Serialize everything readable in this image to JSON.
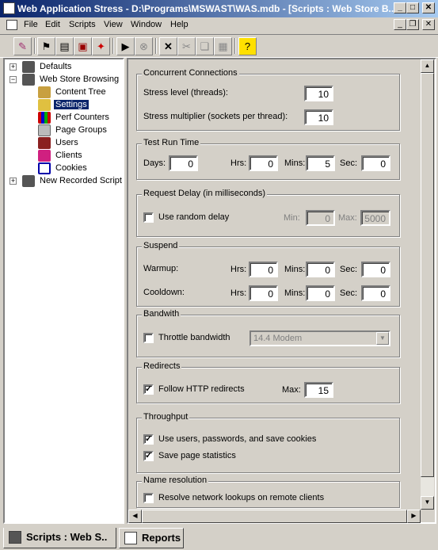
{
  "window": {
    "title": "Web Application Stress - D:\\Programs\\MSWAST\\WAS.mdb - [Scripts : Web Store B...",
    "min": "_",
    "max": "□",
    "close": "✕"
  },
  "menu": [
    "File",
    "Edit",
    "Scripts",
    "View",
    "Window",
    "Help"
  ],
  "toolbar": {
    "icons": [
      "wizard-icon",
      "new-script-icon",
      "properties-icon",
      "db-icon",
      "clients-icon",
      "run-icon",
      "stop-icon",
      "delete-icon",
      "cut-icon",
      "copy-icon",
      "paste-icon",
      "help-icon"
    ]
  },
  "tree": {
    "nodes": [
      {
        "label": "Defaults",
        "level": 0,
        "expander": "+",
        "icon": "flag-icon"
      },
      {
        "label": "Web Store Browsing",
        "level": 0,
        "expander": "−",
        "icon": "flag-icon"
      },
      {
        "label": "Content Tree",
        "level": 1,
        "icon": "content-icon"
      },
      {
        "label": "Settings",
        "level": 1,
        "icon": "settings-icon",
        "selected": true
      },
      {
        "label": "Perf Counters",
        "level": 1,
        "icon": "perf-icon"
      },
      {
        "label": "Page Groups",
        "level": 1,
        "icon": "groups-icon"
      },
      {
        "label": "Users",
        "level": 1,
        "icon": "users-icon"
      },
      {
        "label": "Clients",
        "level": 1,
        "icon": "clients-icon"
      },
      {
        "label": "Cookies",
        "level": 1,
        "icon": "cookies-icon"
      },
      {
        "label": "New Recorded Script",
        "level": 0,
        "expander": "+",
        "icon": "flag-icon"
      }
    ]
  },
  "concurrent": {
    "legend": "Concurrent Connections",
    "stress_label": "Stress level (threads):",
    "stress_value": "10",
    "mult_label": "Stress multiplier (sockets per thread):",
    "mult_value": "10"
  },
  "runtime": {
    "legend": "Test Run Time",
    "days_label": "Days:",
    "days": "0",
    "hrs_label": "Hrs:",
    "hrs": "0",
    "mins_label": "Mins:",
    "mins": "5",
    "sec_label": "Sec:",
    "sec": "0"
  },
  "delay": {
    "legend": "Request Delay (in milliseconds)",
    "random_label": "Use random delay",
    "min_label": "Min:",
    "min": "0",
    "max_label": "Max:",
    "max": "5000"
  },
  "suspend": {
    "legend": "Suspend",
    "warmup_label": "Warmup:",
    "cooldown_label": "Cooldown:",
    "hrs_label": "Hrs:",
    "mins_label": "Mins:",
    "sec_label": "Sec:",
    "w_hrs": "0",
    "w_mins": "0",
    "w_sec": "0",
    "c_hrs": "0",
    "c_mins": "0",
    "c_sec": "0"
  },
  "bandwidth": {
    "legend": "Bandwith",
    "throttle_label": "Throttle bandwidth",
    "speed": "14.4 Modem"
  },
  "redirects": {
    "legend": "Redirects",
    "follow_label": "Follow HTTP redirects",
    "max_label": "Max:",
    "max": "15"
  },
  "throughput": {
    "legend": "Throughput",
    "users_label": "Use users, passwords, and save cookies",
    "stats_label": "Save page statistics"
  },
  "nameres": {
    "legend": "Name resolution",
    "resolve_label": "Resolve network lookups on remote clients"
  },
  "tabs": [
    {
      "label": "Scripts : Web S.."
    },
    {
      "label": "Reports"
    }
  ]
}
